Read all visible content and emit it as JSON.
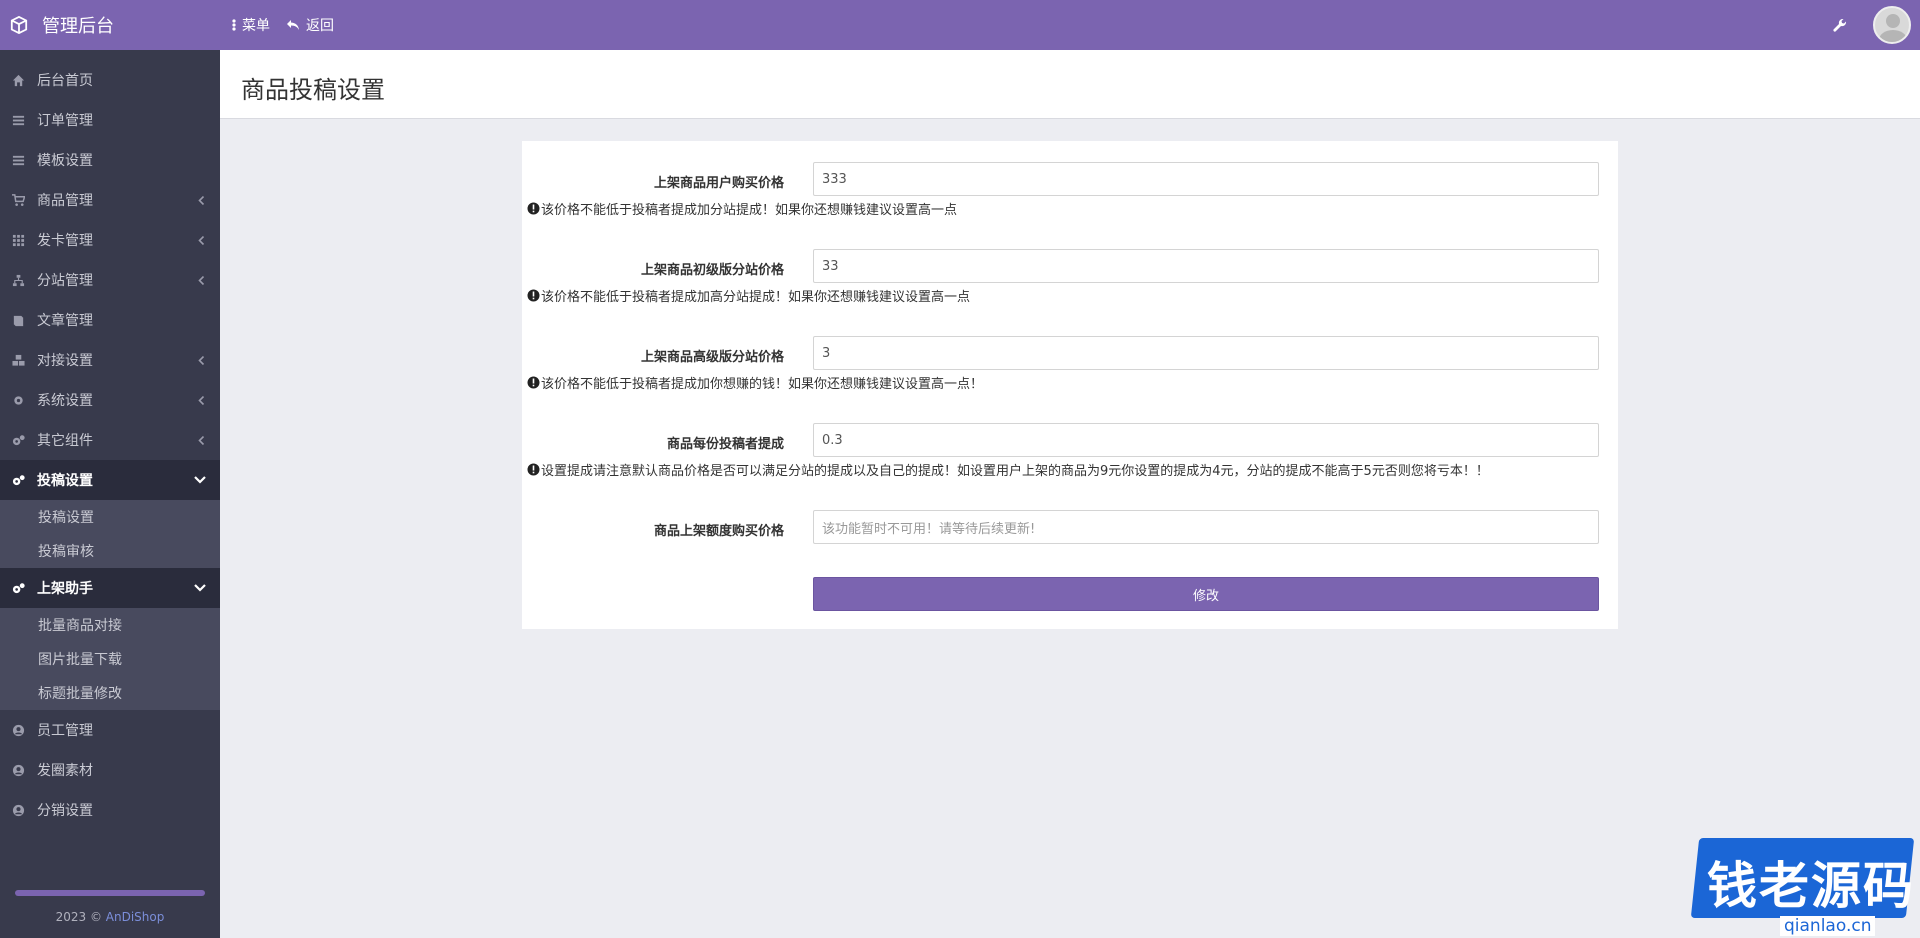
{
  "app": {
    "title": "管理后台"
  },
  "topnav": {
    "menu": "菜单",
    "back": "返回"
  },
  "sidebar": {
    "items": [
      {
        "label": "后台首页",
        "icon": "home-icon"
      },
      {
        "label": "订单管理",
        "icon": "list-icon"
      },
      {
        "label": "模板设置",
        "icon": "list-icon"
      },
      {
        "label": "商品管理",
        "icon": "cart-icon"
      },
      {
        "label": "发卡管理",
        "icon": "grid-icon"
      },
      {
        "label": "分站管理",
        "icon": "sitemap-icon"
      },
      {
        "label": "文章管理",
        "icon": "book-icon"
      },
      {
        "label": "对接设置",
        "icon": "cubes-icon"
      },
      {
        "label": "系统设置",
        "icon": "gear-icon"
      },
      {
        "label": "其它组件",
        "icon": "gears-icon"
      },
      {
        "label": "投稿设置",
        "icon": "gears-icon"
      },
      {
        "label": "上架助手",
        "icon": "gears-icon"
      },
      {
        "label": "员工管理",
        "icon": "user-circle-icon"
      },
      {
        "label": "发圈素材",
        "icon": "user-circle-icon"
      },
      {
        "label": "分销设置",
        "icon": "user-circle-icon"
      }
    ],
    "submenu_submission": [
      "投稿设置",
      "投稿审核"
    ],
    "submenu_listing": [
      "批量商品对接",
      "图片批量下载",
      "标题批量修改"
    ],
    "copyright_prefix": "2023 © ",
    "copyright_brand": "AnDiShop"
  },
  "page": {
    "title": "商品投稿设置"
  },
  "form": {
    "fields": [
      {
        "label": "上架商品用户购买价格",
        "value": "333",
        "help": "该价格不能低于投稿者提成加分站提成！如果你还想赚钱建议设置高一点"
      },
      {
        "label": "上架商品初级版分站价格",
        "value": "33",
        "help": "该价格不能低于投稿者提成加高分站提成！如果你还想赚钱建议设置高一点"
      },
      {
        "label": "上架商品高级版分站价格",
        "value": "3",
        "help": "该价格不能低于投稿者提成加你想赚的钱！如果你还想赚钱建议设置高一点！"
      },
      {
        "label": "商品每份投稿者提成",
        "value": "0.3",
        "help": "设置提成请注意默认商品价格是否可以满足分站的提成以及自己的提成！如设置用户上架的商品为9元你设置的提成为4元，分站的提成不能高于5元否则您将亏本！！"
      },
      {
        "label": "商品上架额度购买价格",
        "placeholder": "该功能暂时不可用！请等待后续更新!"
      }
    ],
    "submit_label": "修改"
  },
  "watermark": {
    "text": "钱老源码",
    "url": "qianlao.cn"
  },
  "colors": {
    "topbar": "#7b64b0",
    "sidebar": "#383a4c",
    "accent": "#7b64b0"
  }
}
